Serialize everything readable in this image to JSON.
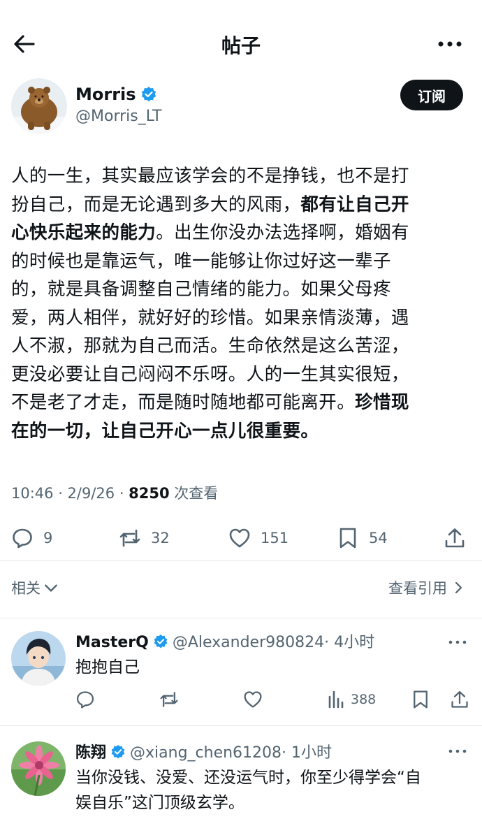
{
  "header": {
    "title": "帖子"
  },
  "post": {
    "author": {
      "name": "Morris",
      "handle": "@Morris_LT"
    },
    "subscribe_label": "订阅",
    "lines": [
      [
        {
          "t": "人的一生，其实最应该学会的不是挣钱，也不是打"
        }
      ],
      [
        {
          "t": "扮自己，而是无论遇到多大的风雨，"
        },
        {
          "t": "都有让自己开",
          "b": true
        }
      ],
      [
        {
          "t": "心快乐起来的能力",
          "b": true
        },
        {
          "t": "。出生你没办法选择啊，婚姻有"
        }
      ],
      [
        {
          "t": "的时候也是靠运气，唯一能够让你过好这一辈子"
        }
      ],
      [
        {
          "t": "的，就是具备调整自己情绪的能力。如果父母疼"
        }
      ],
      [
        {
          "t": "爱，两人相伴，就好好的珍惜。如果亲情淡薄，遇"
        }
      ],
      [
        {
          "t": "人不淑，那就为自己而活。生命依然是这么苦涩，"
        }
      ],
      [
        {
          "t": "更没必要让自己闷闷不乐呀。人的一生其实很短，"
        }
      ],
      [
        {
          "t": "不是老了才走，而是随时随地都可能离开。"
        },
        {
          "t": "珍惜现",
          "b": true
        }
      ],
      [
        {
          "t": "在的一切，让自己开心一点儿很重要。",
          "b": true
        }
      ]
    ],
    "meta": {
      "time": "10:46 · 2/9/26 · ",
      "views": "8250",
      "views_label": " 次查看"
    },
    "stats": {
      "replies": "9",
      "reposts": "32",
      "likes": "151",
      "bookmarks": "54"
    },
    "related_label": "相关",
    "quotes_label": "查看引用"
  },
  "replies": [
    {
      "name": "MasterQ",
      "handle": "@Alexander980824",
      "time": "· 4小时",
      "text_lines": [
        "抱抱自己"
      ],
      "views": "388"
    },
    {
      "name": "陈翔",
      "handle": "@xiang_chen61208",
      "time": "· 1小时",
      "text_lines": [
        "当你没钱、没爱、还没运气时，你至少得学会“自",
        "娱自乐”这门顶级玄学。"
      ]
    }
  ],
  "colors": {
    "text": "#0f1419",
    "secondary": "#536471",
    "verified": "#1d9bf0"
  },
  "icons": [
    "back-arrow-icon",
    "more-icon",
    "verified-icon",
    "reply-icon",
    "repost-icon",
    "like-icon",
    "bookmark-icon",
    "share-icon",
    "views-icon",
    "chevron-down-icon",
    "chevron-right-icon"
  ]
}
